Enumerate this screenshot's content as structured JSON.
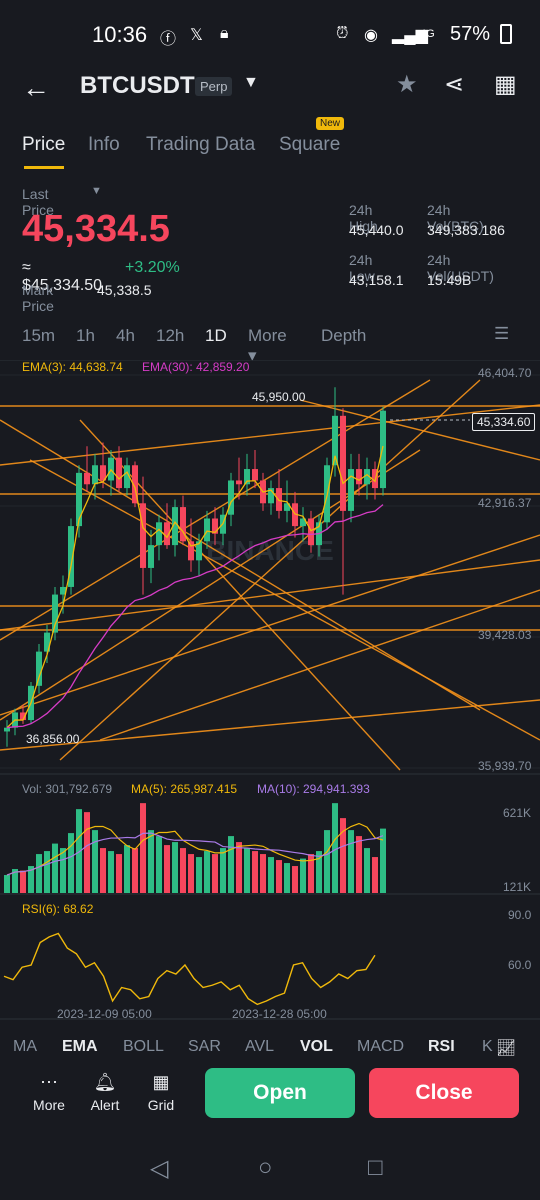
{
  "status_bar": {
    "time": "10:36",
    "battery": "57%",
    "network": "4G"
  },
  "header": {
    "pair": "BTCUSDT",
    "contract_type": "Perp"
  },
  "tabs": [
    {
      "label": "Price"
    },
    {
      "label": "Info"
    },
    {
      "label": "Trading Data"
    },
    {
      "label": "Square"
    }
  ],
  "tabs_badge": "New",
  "price_panel": {
    "last_price_label": "Last Price",
    "last_price": "45,334.5",
    "usd_equiv": "≈ $45,334.50",
    "change_pct": "+3.20%",
    "mark_price_label": "Mark Price",
    "mark_price": "45,338.5",
    "high_label": "24h High",
    "high": "45,440.0",
    "vol_btc_label": "24h Vol(BTC)",
    "vol_btc": "349,383.186",
    "low_label": "24h Low",
    "low": "43,158.1",
    "vol_usdt_label": "24h Vol(USDT)",
    "vol_usdt": "15.49B"
  },
  "timeframes": [
    {
      "label": "15m"
    },
    {
      "label": "1h"
    },
    {
      "label": "4h"
    },
    {
      "label": "12h"
    },
    {
      "label": "1D"
    },
    {
      "label": "More ▾"
    },
    {
      "label": "Depth"
    }
  ],
  "colors": {
    "up": "#2EBD85",
    "down": "#F6465D",
    "accent": "#F0B90B",
    "ema3": "#F0B90B",
    "ema30": "#D63CC6",
    "trend": "#F7931A"
  },
  "chart": {
    "ema3_label": "EMA(3): 44,638.74",
    "ema30_label": "EMA(30): 42,859.20",
    "axis": [
      "46,404.70",
      "42,916.37",
      "39,428.03",
      "35,939.70"
    ],
    "current_price_tag": "45,334.60",
    "high_marker": "45,950.00",
    "low_marker": "36,856.00",
    "watermark": "BINANCE",
    "vol_label": "Vol: 301,792.679",
    "ma5_label": "MA(5): 265,987.415",
    "ma10_label": "MA(10): 294,941.393",
    "vol_axis": [
      "621K",
      "121K"
    ],
    "rsi_label": "RSI(6): 68.62",
    "rsi_axis": [
      "90.0",
      "60.0"
    ],
    "dates": [
      "2023-12-09 05:00",
      "2023-12-28 05:00"
    ]
  },
  "indicators": [
    {
      "label": "MA"
    },
    {
      "label": "EMA"
    },
    {
      "label": "BOLL"
    },
    {
      "label": "SAR"
    },
    {
      "label": "AVL"
    },
    {
      "label": "VOL"
    },
    {
      "label": "MACD"
    },
    {
      "label": "RSI"
    },
    {
      "label": "K"
    }
  ],
  "bottom": {
    "more": "More",
    "alert": "Alert",
    "grid": "Grid",
    "open": "Open",
    "close": "Close"
  },
  "chart_data": {
    "type": "candlestick",
    "ohlc": [
      [
        36900,
        37200,
        36500,
        37000
      ],
      [
        37000,
        37500,
        36800,
        37400
      ],
      [
        37400,
        37600,
        37100,
        37200
      ],
      [
        37200,
        38200,
        37100,
        38100
      ],
      [
        38100,
        39200,
        37900,
        39000
      ],
      [
        39000,
        39700,
        38700,
        39500
      ],
      [
        39500,
        40700,
        39300,
        40500
      ],
      [
        40500,
        41000,
        40000,
        40700
      ],
      [
        40700,
        42500,
        40500,
        42300
      ],
      [
        42300,
        43900,
        42000,
        43700
      ],
      [
        43700,
        44400,
        43200,
        43400
      ],
      [
        43400,
        44200,
        43000,
        43900
      ],
      [
        43900,
        44500,
        43300,
        43500
      ],
      [
        43500,
        44300,
        43100,
        44100
      ],
      [
        44100,
        44400,
        43200,
        43300
      ],
      [
        43300,
        44100,
        43100,
        43900
      ],
      [
        43900,
        44000,
        42800,
        42900
      ],
      [
        42900,
        43600,
        40500,
        41200
      ],
      [
        41200,
        42200,
        40800,
        41800
      ],
      [
        41800,
        42600,
        41400,
        42400
      ],
      [
        42400,
        42900,
        41700,
        41800
      ],
      [
        41800,
        43000,
        41500,
        42800
      ],
      [
        42800,
        43100,
        41800,
        41900
      ],
      [
        41900,
        42500,
        41100,
        41400
      ],
      [
        41400,
        42100,
        41000,
        41900
      ],
      [
        41900,
        42700,
        41700,
        42500
      ],
      [
        42500,
        42800,
        41800,
        42100
      ],
      [
        42100,
        42800,
        41800,
        42600
      ],
      [
        42600,
        43700,
        42300,
        43500
      ],
      [
        43500,
        44100,
        43000,
        43400
      ],
      [
        43400,
        44200,
        43100,
        43800
      ],
      [
        43800,
        44300,
        43300,
        43500
      ],
      [
        43500,
        43700,
        42700,
        42900
      ],
      [
        42900,
        43500,
        42600,
        43300
      ],
      [
        43300,
        43800,
        42500,
        42700
      ],
      [
        42700,
        43500,
        42400,
        42900
      ],
      [
        42900,
        43200,
        42000,
        42300
      ],
      [
        42300,
        42800,
        41900,
        42500
      ],
      [
        42500,
        42700,
        41600,
        41800
      ],
      [
        41800,
        42600,
        41500,
        42400
      ],
      [
        42400,
        44100,
        42200,
        43900
      ],
      [
        43900,
        45950,
        43600,
        45200
      ],
      [
        45200,
        45400,
        40500,
        42700
      ],
      [
        42700,
        44200,
        42400,
        43800
      ],
      [
        43800,
        44200,
        43100,
        43400
      ],
      [
        43400,
        44100,
        43000,
        43800
      ],
      [
        43800,
        44000,
        43000,
        43300
      ],
      [
        43300,
        45440,
        43100,
        45334.5
      ]
    ],
    "volume": [
      120,
      160,
      150,
      180,
      260,
      280,
      330,
      300,
      400,
      560,
      540,
      420,
      300,
      280,
      260,
      320,
      300,
      600,
      420,
      380,
      320,
      340,
      300,
      260,
      240,
      280,
      260,
      300,
      380,
      340,
      300,
      280,
      260,
      240,
      220,
      200,
      180,
      230,
      260,
      280,
      420,
      600,
      500,
      420,
      380,
      300,
      240,
      430
    ],
    "rsi": [
      50,
      47,
      58,
      60,
      80,
      85,
      88,
      75,
      70,
      58,
      62,
      50,
      28,
      40,
      38,
      30,
      32,
      48,
      55,
      52,
      60,
      48,
      40,
      42,
      45,
      38,
      42,
      30,
      25,
      28,
      32,
      35,
      60,
      62,
      48,
      40,
      45,
      52,
      48,
      55,
      56,
      68.62
    ],
    "ylim": [
      35939.7,
      46404.7
    ],
    "rsi_ylim": [
      20,
      100
    ]
  }
}
